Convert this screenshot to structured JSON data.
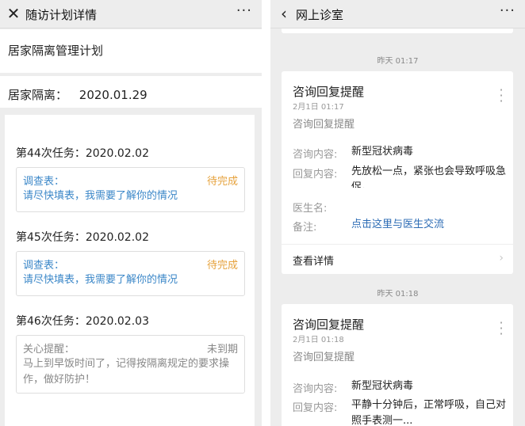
{
  "left": {
    "nav": {
      "title": "随访计划详情",
      "close_icon": "close-icon",
      "more_icon": "more-icon"
    },
    "plan_title": "居家隔离管理计划",
    "isolation": {
      "label": "居家隔离：",
      "date": "2020.01.29"
    },
    "tasks": [
      {
        "header": "第44次任务：2020.02.02",
        "label": "调查表：",
        "status": "待完成",
        "text": "请尽快填表，我需要了解你的情况"
      },
      {
        "header": "第45次任务：2020.02.02",
        "label": "调查表：",
        "status": "待完成",
        "text": "请尽快填表，我需要了解你的情况"
      },
      {
        "header": "第46次任务：2020.02.03",
        "label": "关心提醒：",
        "status": "未到期",
        "text": "马上到早饭时间了，记得按隔离规定的要求操作，做好防护！"
      }
    ]
  },
  "right": {
    "nav": {
      "title": "网上诊室",
      "back_icon": "back-icon",
      "more_icon": "more-icon"
    },
    "messages": [
      {
        "time": "昨天 01:17",
        "title": "咨询回复提醒",
        "date": "2月1日 01:17",
        "subtitle": "咨询回复提醒",
        "fields": [
          {
            "label": "咨询内容:",
            "value": "新型冠状病毒"
          },
          {
            "label": "回复内容:",
            "value": "先放松一点，紧张也会导致呼吸急促。"
          },
          {
            "label": "医生名:",
            "value": ""
          },
          {
            "label": "备注:",
            "value": "点击这里与医生交流"
          }
        ],
        "detail": "查看详情"
      },
      {
        "time": "昨天 01:18",
        "title": "咨询回复提醒",
        "date": "2月1日 01:18",
        "subtitle": "咨询回复提醒",
        "fields": [
          {
            "label": "咨询内容:",
            "value": "新型冠状病毒"
          },
          {
            "label": "回复内容:",
            "value": "平静十分钟后，正常呼吸，自己对照手表测一..."
          }
        ]
      }
    ]
  }
}
